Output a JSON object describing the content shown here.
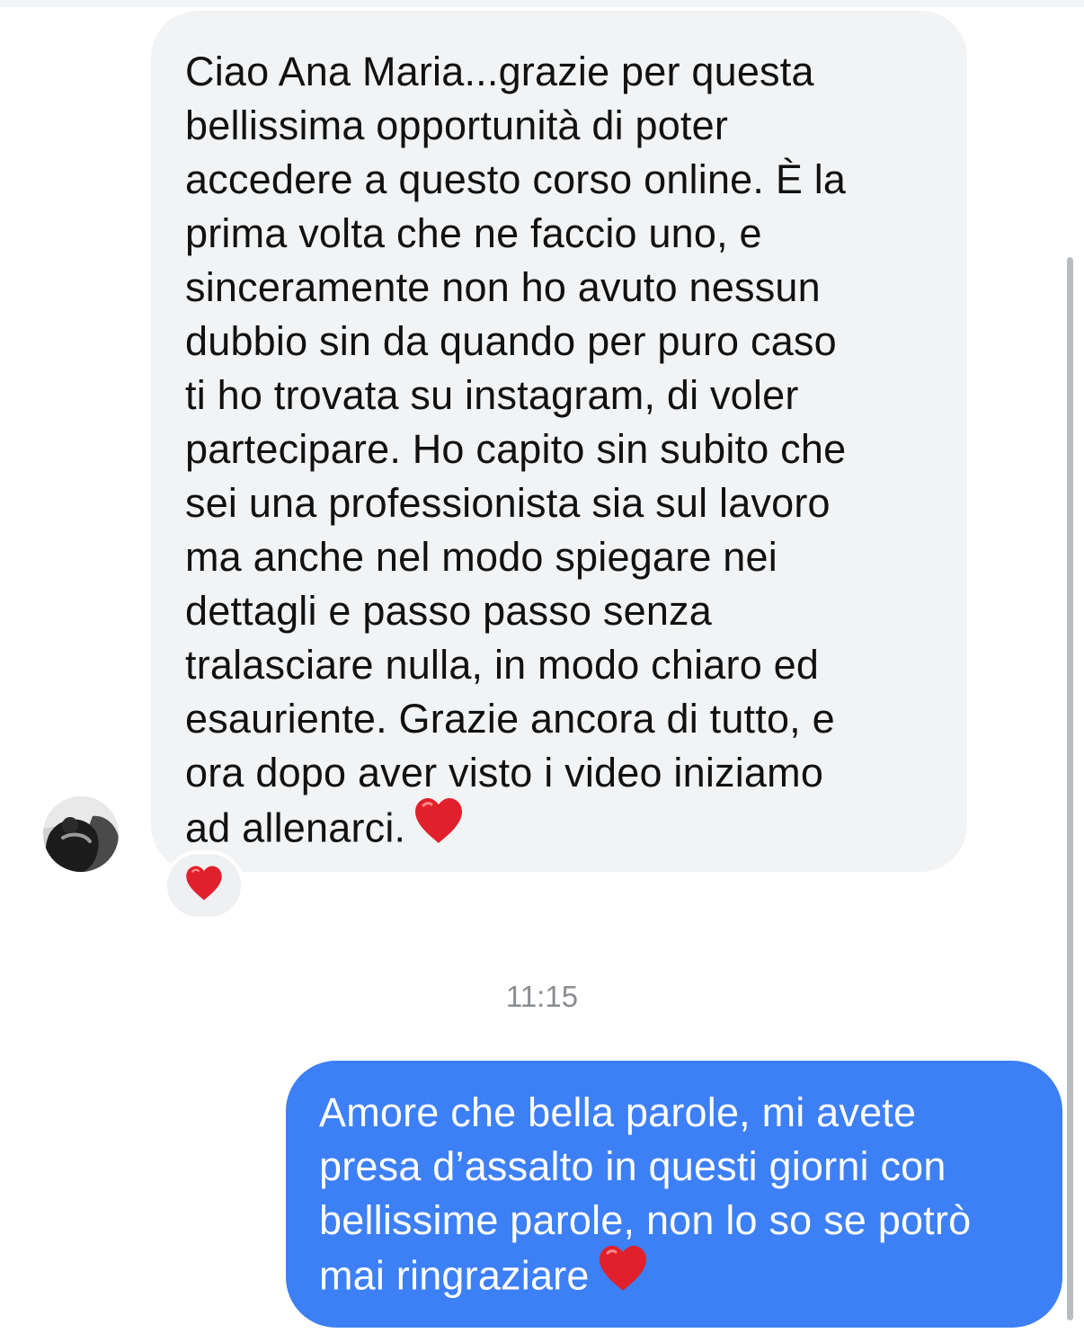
{
  "conversation": {
    "incoming": {
      "lines": [
        "Ciao Ana Maria...grazie per questa",
        "bellissima opportunità di poter",
        "accedere a questo corso online. È la",
        "prima volta che ne faccio uno, e",
        "sinceramente non ho avuto nessun",
        "dubbio sin da quando per puro caso",
        "ti ho trovata su instagram, di voler",
        "partecipare. Ho capito sin  subito che",
        "sei una professionista sia sul lavoro",
        "ma anche nel modo spiegare nei",
        "dettagli e passo passo senza",
        "tralasciare nulla, in modo chiaro ed",
        "esauriente. Grazie ancora di tutto, e",
        "ora dopo aver visto i video iniziamo",
        "ad allenarci."
      ],
      "trailing_emoji": "red-heart",
      "reaction": "red-heart",
      "avatar": "contact-avatar-photo"
    },
    "timestamp": "11:15",
    "outgoing": {
      "lines": [
        "Amore che bella parole, mi avete",
        "presa d’assalto in questi giorni con",
        "bellissime parole, non lo so se potrò",
        "mai ringraziare"
      ],
      "trailing_emoji": "red-heart"
    }
  },
  "colors": {
    "incoming_bubble": "#f1f3f5",
    "outgoing_bubble": "#3d7ff5",
    "incoming_text": "#111111",
    "outgoing_text": "#ffffff",
    "timestamp_text": "#8a8d91",
    "heart": "#e0202a"
  }
}
